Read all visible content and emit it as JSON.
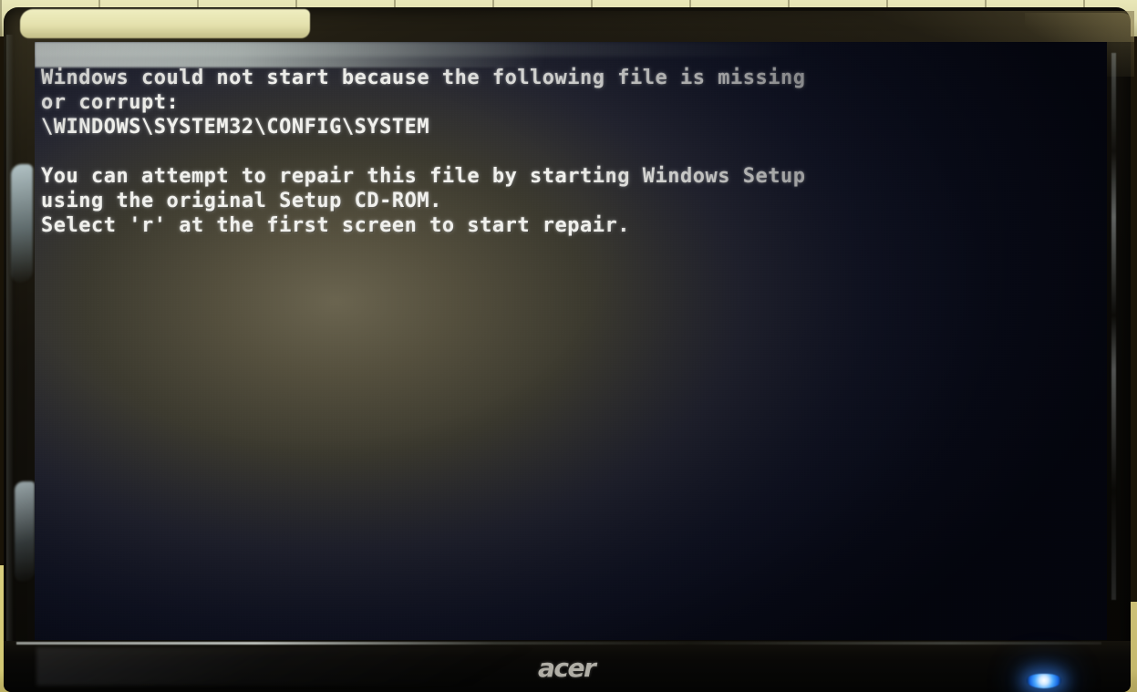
{
  "scene": {
    "device_brand": "acer",
    "device_type": "lcd-monitor",
    "background": "tiled wall and wooden desk"
  },
  "screen": {
    "mode": "text",
    "title": "Windows boot failure message",
    "lines": [
      "Windows could not start because the following file is missing",
      "or corrupt:",
      "\\WINDOWS\\SYSTEM32\\CONFIG\\SYSTEM",
      "",
      "You can attempt to repair this file by starting Windows Setup",
      "using the original Setup CD-ROM.",
      "Select 'r' at the first screen to start repair."
    ],
    "text_color": "#f2f2ee",
    "background_color": "#101428",
    "glow_color": "#6b6550"
  },
  "indicators": {
    "power_led_color": "#2f8cff",
    "power_led_state": "on"
  }
}
